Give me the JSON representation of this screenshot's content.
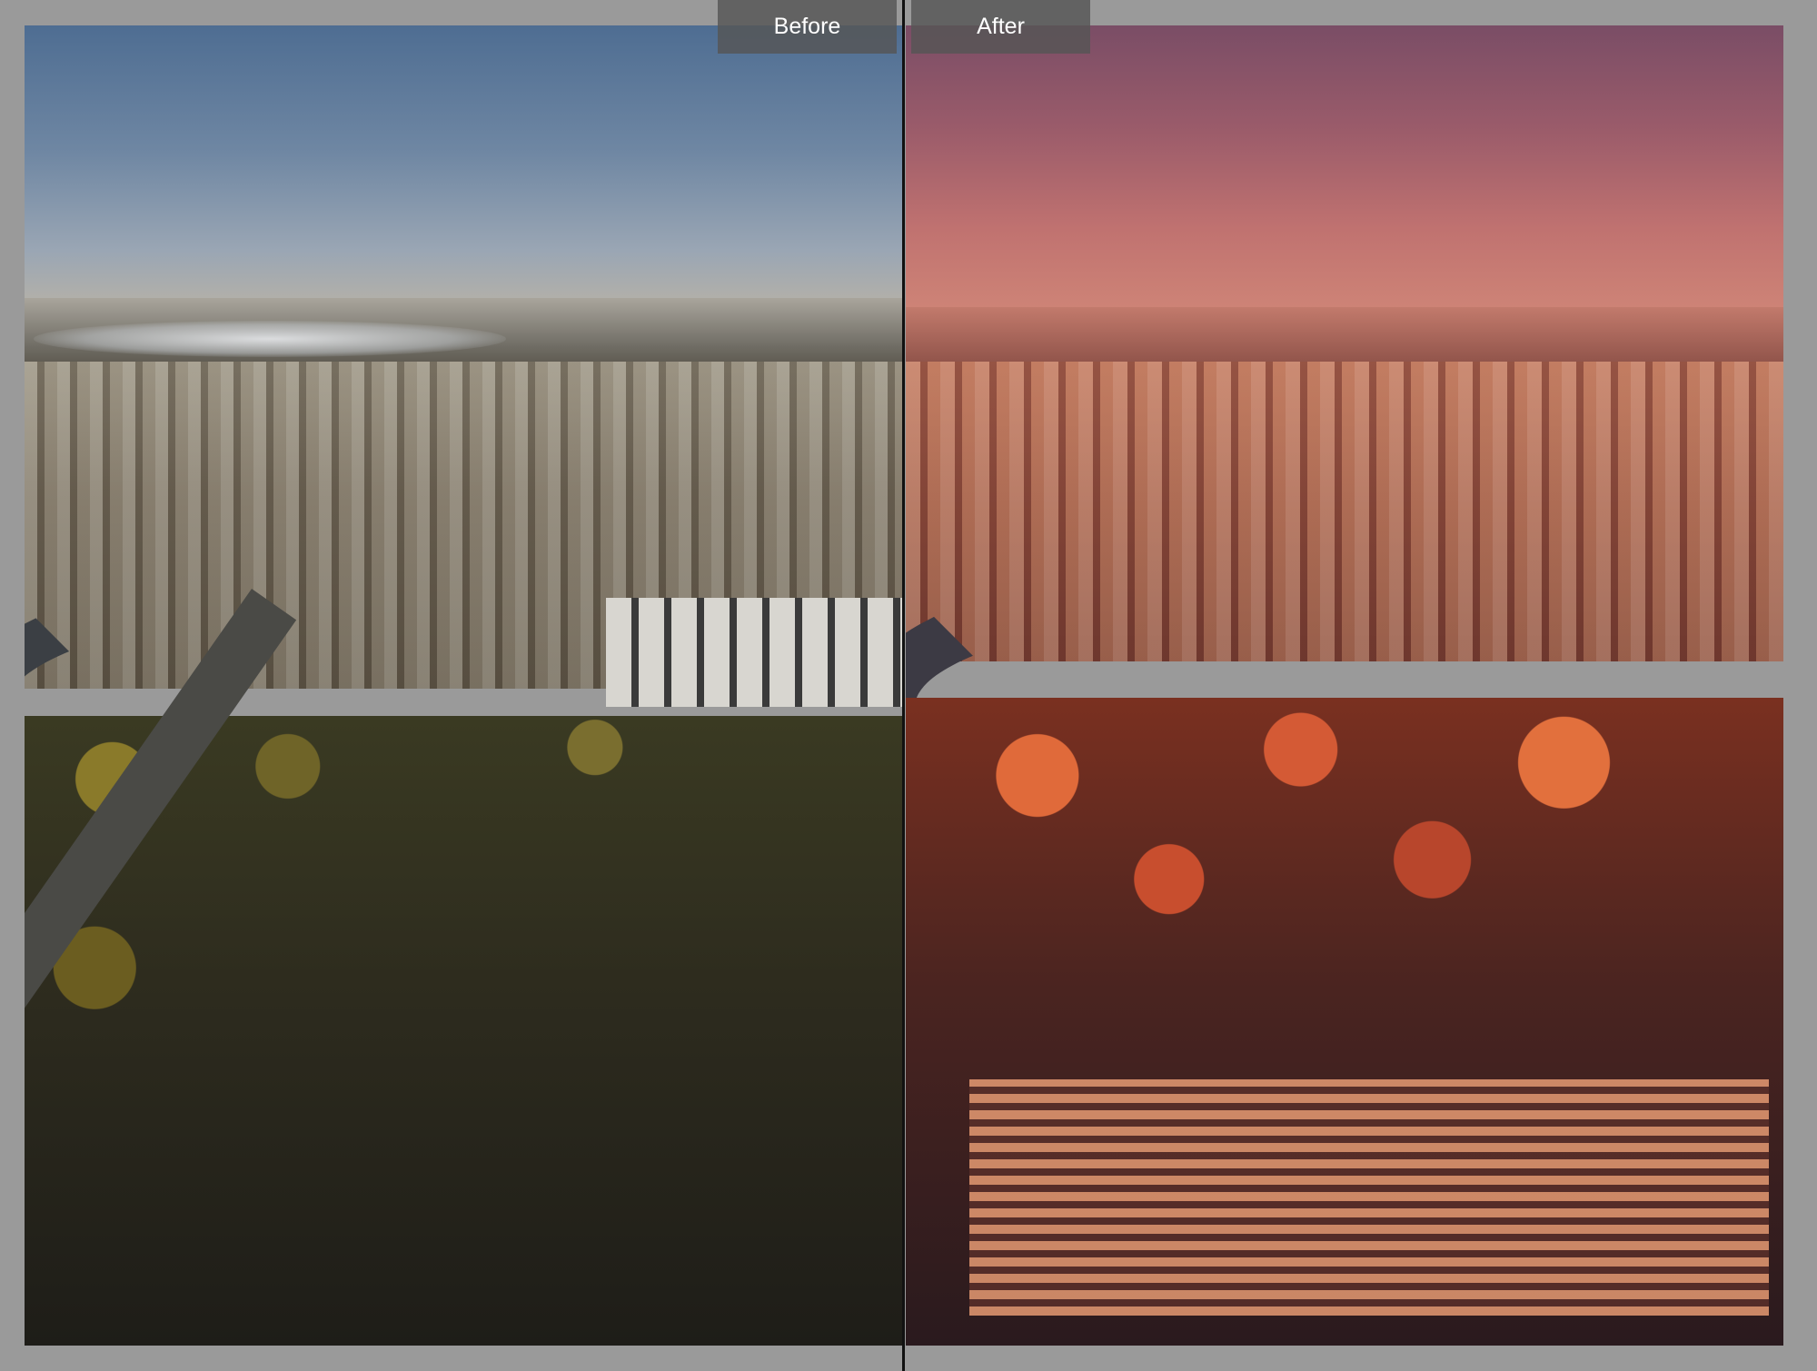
{
  "compare_view": {
    "before_label": "Before",
    "after_label": "After"
  },
  "colors": {
    "background": "#9a9a9a",
    "label_tab": "#555555",
    "divider": "#111111"
  }
}
